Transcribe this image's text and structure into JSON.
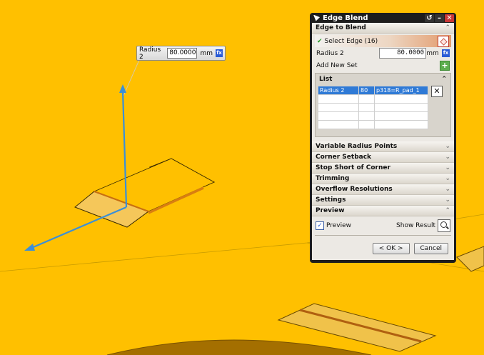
{
  "floating_tag": {
    "label": "Radius 2",
    "value": "80.0000",
    "unit": "mm",
    "fx": "fx"
  },
  "dialog": {
    "title": "Edge Blend",
    "title_buttons": {
      "reset": "↺",
      "minimize": "–",
      "close": "✕"
    },
    "section_edge": "Edge to Blend",
    "select_edge": "Select Edge (16)",
    "radius_label": "Radius 2",
    "radius_value": "80.0000",
    "radius_unit": "mm",
    "fx": "fx",
    "add_new_set": "Add New Set",
    "list_label": "List",
    "list_rows": [
      {
        "c1": "Radius 2",
        "c2": "80",
        "c3": "p318=R_pad_1"
      }
    ],
    "collapsed_sections": [
      "Variable Radius Points",
      "Corner Setback",
      "Stop Short of Corner",
      "Trimming",
      "Overflow Resolutions",
      "Settings"
    ],
    "section_preview": "Preview",
    "preview_checkbox": "Preview",
    "show_result": "Show Result",
    "ok": "< OK >",
    "cancel": "Cancel"
  },
  "colors": {
    "background": "#ffc000",
    "selection": "#2f7ad6",
    "axis": "#3a8fd9"
  }
}
